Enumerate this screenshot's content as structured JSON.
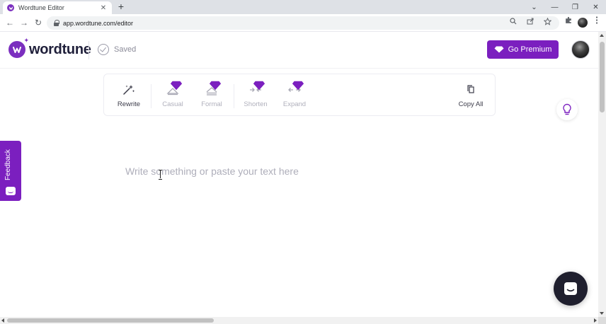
{
  "browser": {
    "tab_title": "Wordtune Editor",
    "tab_close": "✕",
    "new_tab": "+",
    "window_controls": [
      "⌄",
      "—",
      "❐",
      "✕"
    ],
    "url": "app.wordtune.com/editor",
    "nav": {
      "back": "←",
      "forward": "→",
      "reload": "↻"
    },
    "omnibox_icons": [
      "zoom-icon",
      "share-icon",
      "bookmark-star-icon"
    ],
    "extension_icons": [
      "puzzle-icon",
      "profile-icon",
      "menu-kebab-icon"
    ]
  },
  "header": {
    "logo_text": "wordtune",
    "saved_label": "Saved",
    "premium_label": "Go Premium"
  },
  "toolbar": {
    "tools": [
      {
        "label": "Rewrite",
        "icon": "sparkles-icon",
        "premium": false,
        "active": true
      },
      {
        "label": "Casual",
        "icon": "casual-icon",
        "premium": true,
        "active": false
      },
      {
        "label": "Formal",
        "icon": "formal-icon",
        "premium": true,
        "active": false
      },
      {
        "label": "Shorten",
        "icon": "shorten-icon",
        "premium": true,
        "active": false
      },
      {
        "label": "Expand",
        "icon": "expand-icon",
        "premium": true,
        "active": false
      }
    ],
    "copy_all_label": "Copy All"
  },
  "editor": {
    "placeholder": "Write something or paste your text here"
  },
  "feedback": {
    "label": "Feedback"
  },
  "colors": {
    "brand_purple": "#7b1fbf",
    "chat_bg": "#1f1f2e"
  }
}
